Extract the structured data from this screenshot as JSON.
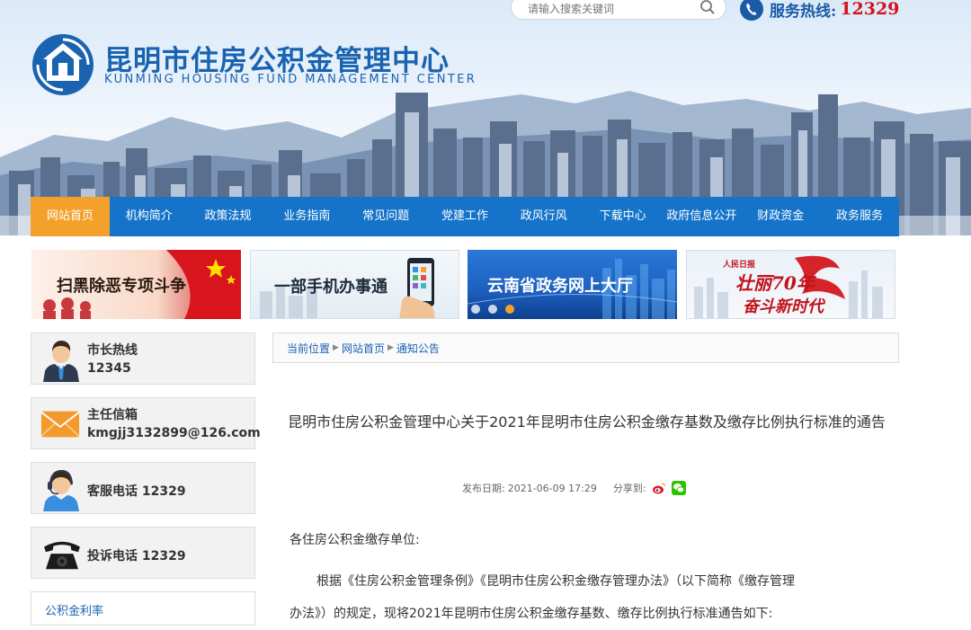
{
  "header": {
    "title": "昆明市住房公积金管理中心",
    "subtitle": "KUNMING HOUSING FUND MANAGEMENT CENTER",
    "search_placeholder": "请输入搜索关键词",
    "hotline_label": "服务热线:",
    "hotline_number": "12329",
    "colors": {
      "brand": "#1a63b0",
      "hotline": "#d4121b"
    }
  },
  "nav": {
    "items": [
      "网站首页",
      "机构简介",
      "政策法规",
      "业务指南",
      "常见问题",
      "党建工作",
      "政风行风",
      "下载中心",
      "政府信息公开",
      "财政资金",
      "政务服务"
    ],
    "active_index": 0,
    "colors": {
      "bar": "#1574c9",
      "active": "#f3a12a"
    }
  },
  "banners": [
    {
      "text": "扫黑除恶专项斗争"
    },
    {
      "text": "一部手机办事通"
    },
    {
      "text": "云南省政务网上大厅"
    },
    {
      "text_line1": "壮丽70年",
      "text_line2": "奋斗新时代"
    }
  ],
  "sidebar": {
    "mayor": {
      "label": "市长热线",
      "value": "12345",
      "icon": "person-icon"
    },
    "director": {
      "label": "主任信箱",
      "value": "kmgjj3132899@126.com",
      "icon": "envelope-icon"
    },
    "service": {
      "label": "客服电话 12329",
      "icon": "headset-icon"
    },
    "complaint": {
      "label": "投诉电话 12329",
      "icon": "telephone-icon"
    },
    "rate_title": "公积金利率"
  },
  "breadcrumb": {
    "items": [
      "当前位置",
      "网站首页",
      "通知公告"
    ]
  },
  "article": {
    "title": "昆明市住房公积金管理中心关于2021年昆明市住房公积金缴存基数及缴存比例执行标准的通告",
    "date_label": "发布日期:",
    "date": "2021-06-09 17:29",
    "share_label": "分享到:",
    "salutation": "各住房公积金缴存单位:",
    "body_line1": "根据《住房公积金管理条例》《昆明市住房公积金缴存管理办法》（以下简称《缴存管理",
    "body_line2": "办法》）的规定，现将2021年昆明市住房公积金缴存基数、缴存比例执行标准通告如下:"
  }
}
